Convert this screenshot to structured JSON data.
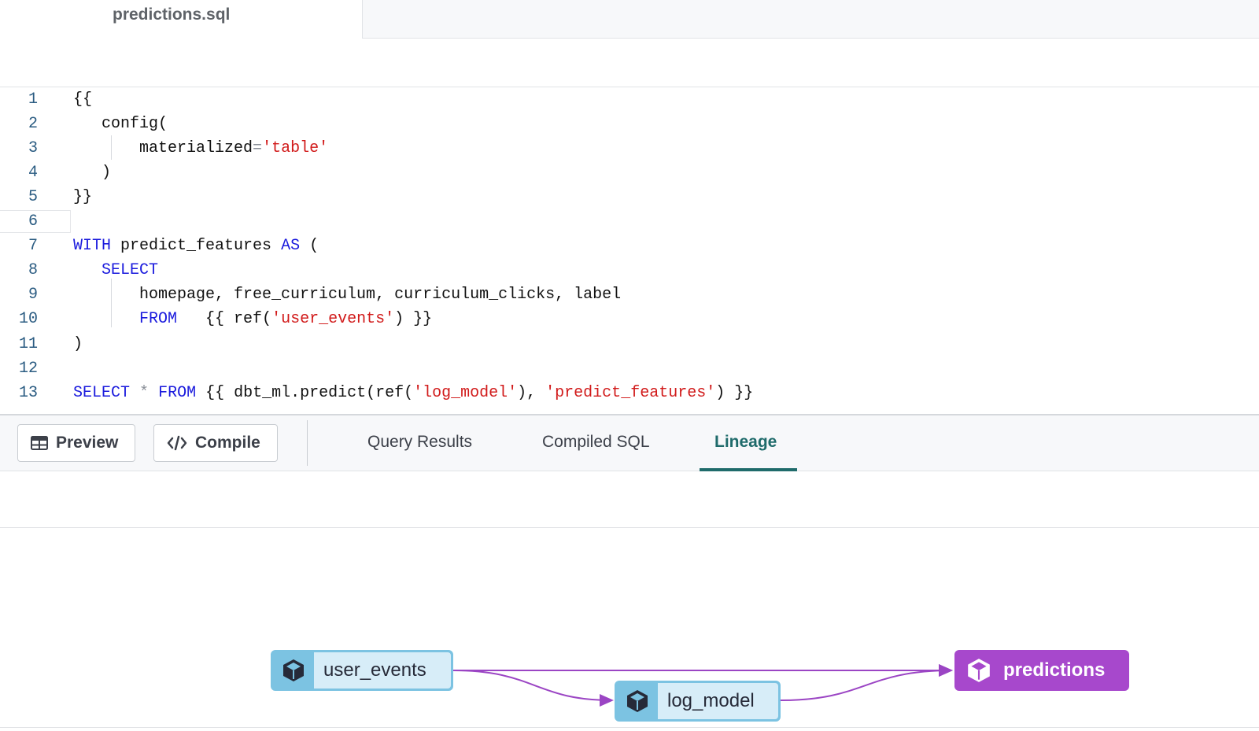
{
  "file_tab": {
    "title": "predictions.sql"
  },
  "editor": {
    "lines": [
      {
        "num": "1",
        "segments": [
          {
            "t": "{{",
            "c": "plain"
          }
        ]
      },
      {
        "num": "2",
        "segments": [
          {
            "t": "   config(",
            "c": "plain"
          }
        ]
      },
      {
        "num": "3",
        "segments": [
          {
            "t": "       materialized",
            "c": "plain"
          },
          {
            "t": "=",
            "c": "op"
          },
          {
            "t": "'table'",
            "c": "str"
          }
        ]
      },
      {
        "num": "4",
        "segments": [
          {
            "t": "   )",
            "c": "plain"
          }
        ]
      },
      {
        "num": "5",
        "segments": [
          {
            "t": "}}",
            "c": "plain"
          }
        ]
      },
      {
        "num": "6",
        "segments": []
      },
      {
        "num": "7",
        "segments": [
          {
            "t": "WITH",
            "c": "kw"
          },
          {
            "t": " predict_features ",
            "c": "plain"
          },
          {
            "t": "AS",
            "c": "kw"
          },
          {
            "t": " (",
            "c": "plain"
          }
        ]
      },
      {
        "num": "8",
        "segments": [
          {
            "t": "   ",
            "c": "plain"
          },
          {
            "t": "SELECT",
            "c": "kw"
          }
        ]
      },
      {
        "num": "9",
        "segments": [
          {
            "t": "       homepage, free_curriculum, curriculum_clicks, label",
            "c": "plain"
          }
        ]
      },
      {
        "num": "10",
        "segments": [
          {
            "t": "       ",
            "c": "plain"
          },
          {
            "t": "FROM",
            "c": "kw"
          },
          {
            "t": "   {{ ref(",
            "c": "plain"
          },
          {
            "t": "'user_events'",
            "c": "str"
          },
          {
            "t": ") }}",
            "c": "plain"
          }
        ]
      },
      {
        "num": "11",
        "segments": [
          {
            "t": ")",
            "c": "plain"
          }
        ]
      },
      {
        "num": "12",
        "segments": []
      },
      {
        "num": "13",
        "segments": [
          {
            "t": "SELECT",
            "c": "kw"
          },
          {
            "t": " ",
            "c": "plain"
          },
          {
            "t": "*",
            "c": "op"
          },
          {
            "t": " ",
            "c": "plain"
          },
          {
            "t": "FROM",
            "c": "kw"
          },
          {
            "t": " {{ dbt_ml.predict(ref(",
            "c": "plain"
          },
          {
            "t": "'log_model'",
            "c": "str"
          },
          {
            "t": "), ",
            "c": "plain"
          },
          {
            "t": "'predict_features'",
            "c": "str"
          },
          {
            "t": ") }}",
            "c": "plain"
          }
        ]
      }
    ],
    "cursor_line": "6"
  },
  "toolbar": {
    "preview_label": "Preview",
    "preview_icon": "table-icon",
    "compile_label": "Compile",
    "compile_icon": "code-icon"
  },
  "result_tabs": [
    {
      "label": "Query Results",
      "active": false
    },
    {
      "label": "Compiled SQL",
      "active": false
    },
    {
      "label": "Lineage",
      "active": true
    }
  ],
  "lineage": {
    "nodes": [
      {
        "label": "user_events",
        "kind": "source",
        "icon": "cube-icon"
      },
      {
        "label": "log_model",
        "kind": "source",
        "icon": "cube-icon"
      },
      {
        "label": "predictions",
        "kind": "selected",
        "icon": "cube-icon"
      }
    ],
    "edges": [
      {
        "from": "user_events",
        "to": "predictions"
      },
      {
        "from": "user_events",
        "to": "log_model"
      },
      {
        "from": "log_model",
        "to": "predictions"
      }
    ],
    "colors": {
      "source_fill": "#7cc3e2",
      "selected_fill": "#a748cc",
      "edge": "#9b45c4"
    }
  }
}
